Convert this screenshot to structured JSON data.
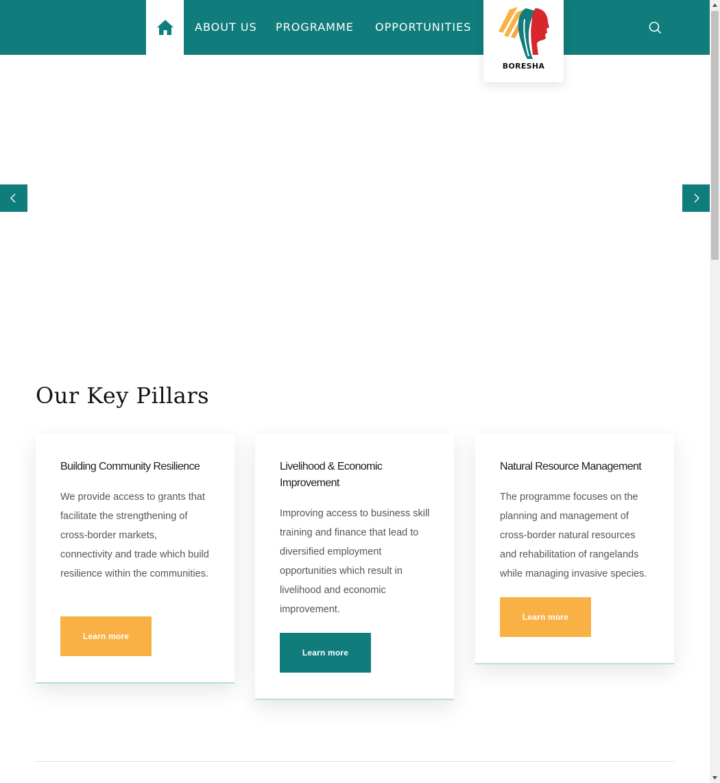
{
  "nav": {
    "items": [
      {
        "label": "ABOUT US"
      },
      {
        "label": "PROGRAMME"
      },
      {
        "label": "OPPORTUNITIES"
      }
    ],
    "logo_text": "BORESHA",
    "home_icon": "home-icon",
    "search_icon": "search-icon"
  },
  "slider": {
    "prev_icon": "chevron-left-icon",
    "next_icon": "chevron-right-icon"
  },
  "pillars": {
    "title": "Our Key Pillars",
    "cards": [
      {
        "title": "Building Community Resilience",
        "text": "We provide access to grants that facilitate the strengthening of cross-border markets, connectivity and trade which build resilience within the communities.",
        "button": "Learn more",
        "button_color": "#f9b145"
      },
      {
        "title": "Livelihood & Economic Improvement",
        "text": "Improving access to business skill training and finance that lead to diversified employment opportunities which result in livelihood and economic improvement.",
        "button": "Learn more",
        "button_color": "#117c7c"
      },
      {
        "title": "Natural Resource Management",
        "text": "The programme focuses on the planning and management of cross-border natural resources and rehabilitation of rangelands while managing invasive species.",
        "button": "Learn more",
        "button_color": "#f9b145"
      }
    ]
  },
  "colors": {
    "primary": "#117c7c",
    "accent": "#f9b145"
  }
}
